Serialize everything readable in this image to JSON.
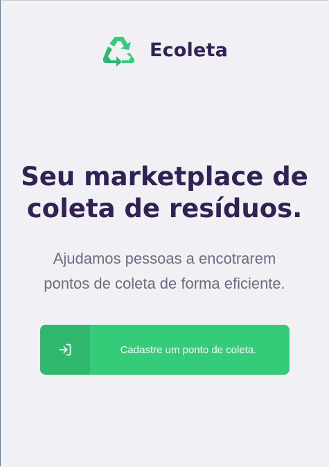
{
  "header": {
    "logo_icon": "recycle-icon",
    "brand_name": "Ecoleta"
  },
  "hero": {
    "headline_line1": "Seu marketplace de",
    "headline_line2": "coleta de resíduos.",
    "subtitle_line1": "Ajudamos pessoas a encotrarem",
    "subtitle_line2": "pontos de coleta de forma eficiente."
  },
  "cta": {
    "icon": "log-in-icon",
    "label": "Cadastre um ponto de coleta."
  },
  "colors": {
    "background": "#f0f0f5",
    "title": "#322153",
    "text": "#6c6c80",
    "primary": "#34cb79",
    "primary_dark": "#2fb86e"
  }
}
